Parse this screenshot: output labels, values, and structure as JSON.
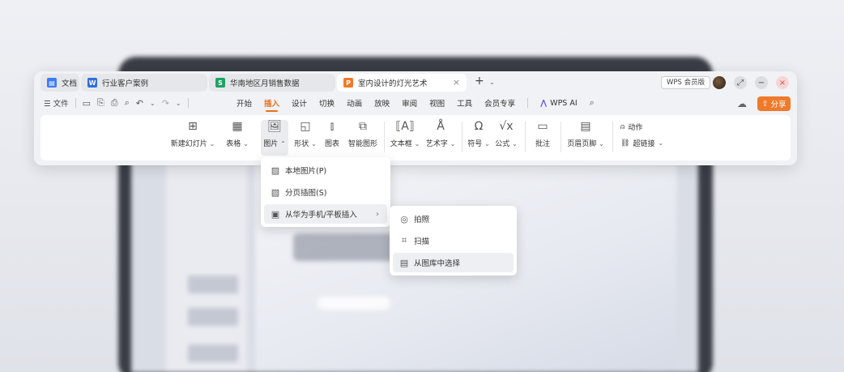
{
  "tabs": [
    {
      "label": "文档",
      "icon": "docs-app-icon",
      "color": "#3b7cf5"
    },
    {
      "label": "行业客户案例",
      "icon": "word-app-icon",
      "color": "#2f6fe0",
      "glyph": "W"
    },
    {
      "label": "华南地区月销售数据",
      "icon": "sheet-app-icon",
      "color": "#1ea362",
      "glyph": "S"
    },
    {
      "label": "室内设计的灯光艺术",
      "icon": "ppt-app-icon",
      "color": "#f07a2a",
      "glyph": "P"
    }
  ],
  "titlebar": {
    "new_tab": "+",
    "member_badge": "WPS 会员版"
  },
  "menubar": {
    "file_label": "文件",
    "items": [
      "开始",
      "插入",
      "设计",
      "切换",
      "动画",
      "放映",
      "审阅",
      "视图",
      "工具",
      "会员专享"
    ],
    "active": "插入",
    "wps_ai": "WPS AI",
    "share_label": "分享"
  },
  "ribbon": {
    "new_slide": "新建幻灯片",
    "table": "表格",
    "picture": "图片",
    "shape": "形状",
    "chart": "图表",
    "smart_art": "智能图形",
    "textbox": "文本框",
    "wordart": "艺术字",
    "symbol": "符号",
    "formula": "公式",
    "comment": "批注",
    "header_footer": "页眉页脚",
    "action": "动作",
    "hyperlink": "超链接"
  },
  "picture_menu": {
    "items": [
      {
        "label": "本地图片(P)",
        "icon": "local-image-icon"
      },
      {
        "label": "分页插图(S)",
        "icon": "paged-image-icon"
      },
      {
        "label": "从华为手机/平板插入",
        "icon": "huawei-device-icon"
      }
    ]
  },
  "device_menu": {
    "items": [
      {
        "label": "拍照",
        "icon": "camera-icon"
      },
      {
        "label": "扫描",
        "icon": "scan-icon"
      },
      {
        "label": "从图库中选择",
        "icon": "gallery-icon"
      }
    ]
  },
  "colors": {
    "accent": "#e8711a",
    "share_bg": "#ee7a2b"
  }
}
